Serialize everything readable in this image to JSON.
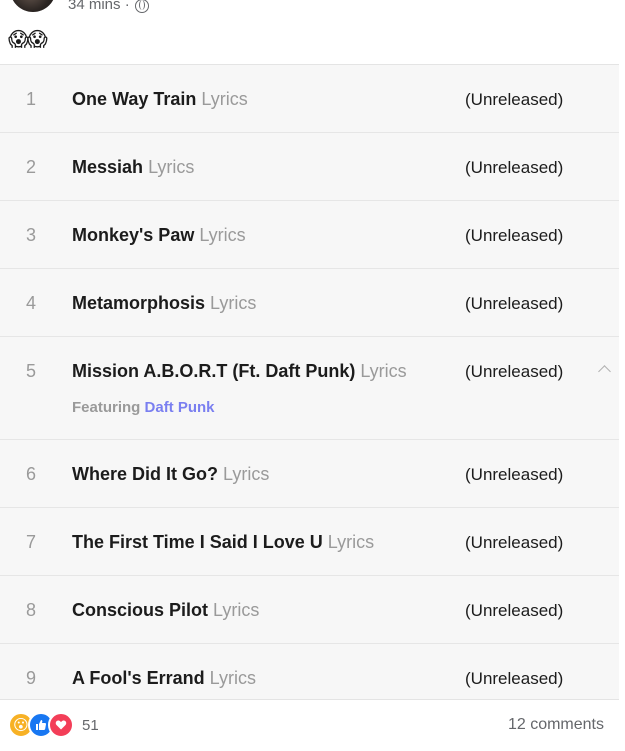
{
  "post": {
    "time": "34 mins ·",
    "reaction_emojis": "😱😱"
  },
  "tracks": [
    {
      "num": "1",
      "title": "One Way Train",
      "lyrics": "Lyrics",
      "status": "(Unreleased)"
    },
    {
      "num": "2",
      "title": "Messiah",
      "lyrics": "Lyrics",
      "status": "(Unreleased)"
    },
    {
      "num": "3",
      "title": "Monkey's Paw",
      "lyrics": "Lyrics",
      "status": "(Unreleased)"
    },
    {
      "num": "4",
      "title": "Metamorphosis",
      "lyrics": "Lyrics",
      "status": "(Unreleased)"
    },
    {
      "num": "5",
      "title": "Mission A.B.O.R.T (Ft. Daft Punk)",
      "lyrics": "Lyrics",
      "status": "(Unreleased)",
      "featuring_label": "Featuring",
      "featuring_artist": "Daft Punk"
    },
    {
      "num": "6",
      "title": "Where Did It Go?",
      "lyrics": "Lyrics",
      "status": "(Unreleased)"
    },
    {
      "num": "7",
      "title": "The First Time I Said I Love U",
      "lyrics": "Lyrics",
      "status": "(Unreleased)"
    },
    {
      "num": "8",
      "title": "Conscious Pilot",
      "lyrics": "Lyrics",
      "status": "(Unreleased)"
    },
    {
      "num": "9",
      "title": "A Fool's Errand",
      "lyrics": "Lyrics",
      "status": "(Unreleased)"
    }
  ],
  "footer": {
    "reaction_icons": [
      "wow-icon",
      "like-icon",
      "love-icon"
    ],
    "reaction_count": "51",
    "comments": "12 comments"
  },
  "colors": {
    "accent_link": "#7a7ff0",
    "like_blue": "#1877f2",
    "love_red": "#f33e58",
    "wow_yellow": "#f7b125"
  }
}
